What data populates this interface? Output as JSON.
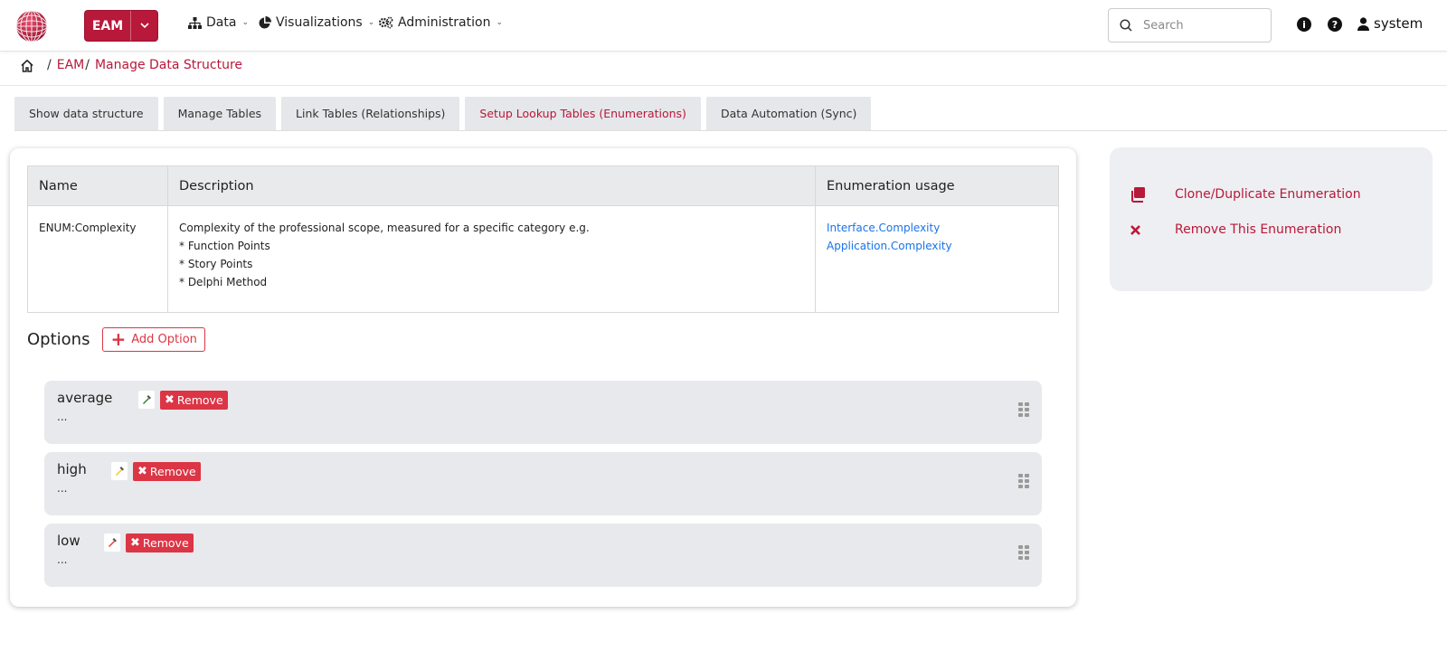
{
  "header": {
    "app_label": "EAM",
    "nav": [
      {
        "label": "Data",
        "icon": "sitemap-icon"
      },
      {
        "label": "Visualizations",
        "icon": "pie-chart-icon"
      },
      {
        "label": "Administration",
        "icon": "cogs-icon"
      }
    ],
    "search_placeholder": "Search",
    "user": "system"
  },
  "breadcrumb": {
    "items": [
      "EAM",
      "Manage Data Structure"
    ],
    "separator": "/"
  },
  "tabs": [
    {
      "label": "Show data structure",
      "active": false
    },
    {
      "label": "Manage Tables",
      "active": false
    },
    {
      "label": "Link Tables (Relationships)",
      "active": false
    },
    {
      "label": "Setup Lookup Tables (Enumerations)",
      "active": true
    },
    {
      "label": "Data Automation (Sync)",
      "active": false
    }
  ],
  "enumeration": {
    "headers": {
      "name": "Name",
      "description": "Description",
      "usage": "Enumeration usage"
    },
    "name": "ENUM:Complexity",
    "description_lines": [
      "Complexity of the professional scope, measured for a specific category e.g.",
      "* Function Points",
      "* Story Points",
      "* Delphi Method"
    ],
    "usage": [
      "Interface.Complexity",
      "Application.Complexity"
    ]
  },
  "options": {
    "title": "Options",
    "add_label": "Add Option",
    "remove_label": "Remove",
    "items": [
      {
        "name": "average",
        "value": "...",
        "color": "#2e7d32"
      },
      {
        "name": "high",
        "value": "...",
        "color": "#f4c430"
      },
      {
        "name": "low",
        "value": "...",
        "color": "#e53935"
      }
    ]
  },
  "actions": {
    "clone_label": "Clone/Duplicate Enumeration",
    "remove_label": "Remove This Enumeration"
  },
  "colors": {
    "brand": "#b8183a",
    "danger": "#dc3545",
    "link": "#1a73e8"
  }
}
